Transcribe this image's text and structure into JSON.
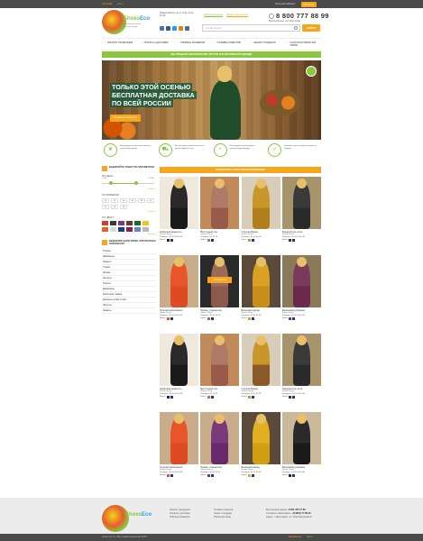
{
  "topbar": {
    "lang_ru": "Русский",
    "lang_en": "Англ.",
    "account": "Личный кабинет",
    "register": "Регистр."
  },
  "header": {
    "brand_a": "Shoes",
    "brand_b": "Eco",
    "tagline": "экологически чистая женская одежда",
    "schedule": "Режим работы: пн-пт 9-18, сб-вс 10-16",
    "callback": "Обратный звонок",
    "call_free": "Звонок бесплатный",
    "phone": "8 800 777 88 99",
    "phone_sub": "бесплатно по России"
  },
  "search": {
    "placeholder": "Что Вы ищете?",
    "button": "НАЙТИ"
  },
  "nav": {
    "items": [
      {
        "label": "КАТАЛОГ ПРОДУКЦИИ"
      },
      {
        "label": "ОПЛАТА И ДОСТАВКА"
      },
      {
        "label": "ТАБЛИЦА РАЗМЕРОВ"
      },
      {
        "label": "ОТЗЫВЫ КЛИЕНТОВ"
      },
      {
        "label": "АКЦИИ И ПОДАРКИ"
      },
      {
        "label": "КОНТАКТЫ ОБРАТНАЯ СВЯЗЬ"
      }
    ]
  },
  "banner_strip": "МЫ ПРОДАЕМ ЭКОЛОГИЧЕСКИ ЧИСТУЮ И КАЧЕСТВЕННУЮ ОДЕЖДУ",
  "hero": {
    "line1": "ТОЛЬКО ЭТОЙ ОСЕНЬЮ",
    "line2": "БЕСПЛАТНАЯ ДОСТАВКА",
    "line3": "ПО ВСЕЙ РОССИИ",
    "cta": "Перейти в каталог"
  },
  "features": [
    {
      "text": "Используем только экологически чистые материалы"
    },
    {
      "text": "Мы доставим товар бесплатно в любой город России"
    },
    {
      "text": "Мы продаем экологичную и качественную одежду"
    },
    {
      "text": "Большой опыт в сфере розничных продаж"
    }
  ],
  "filters": {
    "title": "ВЫБИРАЙТЕ ТОВАР ПО ПАРАМЕТРАМ",
    "price_label": "ПО ЦЕНЕ",
    "price_min": "1 000",
    "price_max": "15 000",
    "reset": "Сбросить",
    "size_label": "ПО РАЗМЕРАМ",
    "sizes": [
      "40",
      "42",
      "44",
      "46",
      "48",
      "50",
      "52",
      "54",
      "56"
    ],
    "color_label": "ПО ЦВЕТУ",
    "colors": [
      "#d93a2b",
      "#3b3b3b",
      "#7a3a8c",
      "#6b3a1f",
      "#1f6b2a",
      "#e8c81b",
      "#e5602a",
      "#d9d9d9",
      "#1f3a8c",
      "#8c1f4d",
      "#5a8cc6",
      "#b8b8b8"
    ],
    "cats_title": "ВЫБЕРИТЕ КАТЕГОРИЮ, КОТОРАЯ ВАС ИНТЕРЕСУЕТ",
    "categories": [
      "Платья",
      "Джемперы",
      "Жакеты",
      "Туники",
      "Штаны",
      "Жилеты",
      "Платья",
      "Джемперы",
      "Категория товара",
      "Длинное слово слово",
      "Жилеты",
      "Жакеты"
    ]
  },
  "catalog": {
    "title": "ПОСМОТРИТЕ НАШУ НОВУЮ КОЛЛЕКЦИЮ",
    "hot_label": "Посмотреть",
    "brand_label": "Фирма",
    "sizes_prefix": "Размеры:",
    "colors_prefix": "Цвета:",
    "products": [
      {
        "name": "Небесная нежность",
        "brand": "Nepal",
        "sizes": "40 42 44 46 48",
        "top": "#2a2a2a",
        "bottom": "#1a1a1a",
        "bg": "#efe8dc"
      },
      {
        "name": "Восточный сон",
        "brand": "Nepal",
        "sizes": "40 42 44",
        "top": "#b07a6a",
        "bottom": "#9a5a4a",
        "bg": "#c08a5a"
      },
      {
        "name": "Строгая Бриен",
        "brand": "Nepal",
        "sizes": "40 42 44 46",
        "top": "#c9962a",
        "bottom": "#b07e1a",
        "bg": "#d8cdb8"
      },
      {
        "name": "Разделитель ночи",
        "brand": "Nepal",
        "sizes": "40 42 44 46 48",
        "top": "#3a3a3a",
        "bottom": "#2a2a2a",
        "bg": "#a8946c"
      },
      {
        "name": "Лучший комплимент",
        "brand": "Nepal",
        "sizes": "40 42 44 46 48",
        "top": "#e8552a",
        "bottom": "#e04a22",
        "bg": "#c9ad8a"
      },
      {
        "name": "Привет, романтика",
        "brand": "Nepal",
        "sizes": "40 42 44 46",
        "top": "#9c6a5a",
        "bottom": "#8a5a4a",
        "bg": "#2a2a2a"
      },
      {
        "name": "Вечерний наряд",
        "brand": "Nepal",
        "sizes": "40 42 44 46",
        "top": "#d9a024",
        "bottom": "#c88e1a",
        "bg": "#5a4a3a"
      },
      {
        "name": "Фиалковая рубашка",
        "brand": "Nepal",
        "sizes": "40 42 44 46 48",
        "top": "#7a3a5a",
        "bottom": "#6a2a4a",
        "bg": "#8a7a5a"
      },
      {
        "name": "Небесная нежность",
        "brand": "Nepal",
        "sizes": "40 42 44 46 48",
        "top": "#2a2a2a",
        "bottom": "#1a1a1a",
        "bg": "#efe8dc"
      },
      {
        "name": "Восточный сон",
        "brand": "Nepal",
        "sizes": "40 42 44",
        "top": "#b07a6a",
        "bottom": "#9a5a4a",
        "bg": "#c08a5a"
      },
      {
        "name": "Строгая Бриен",
        "brand": "Nepal",
        "sizes": "40 42 44 46",
        "top": "#c9962a",
        "bottom": "#8a5a2a",
        "bg": "#d8cdb8"
      },
      {
        "name": "Разделитель ночи",
        "brand": "Nepal",
        "sizes": "40 42 44 46 48",
        "top": "#3a3a3a",
        "bottom": "#2a2a2a",
        "bg": "#a8946c"
      },
      {
        "name": "Лучший комплимент",
        "brand": "Nepal",
        "sizes": "40 42 44 46 48",
        "top": "#e8552a",
        "bottom": "#e04a22",
        "bg": "#c9ad8a"
      },
      {
        "name": "Привет, романтика",
        "brand": "Nepal",
        "sizes": "40 42 44 46",
        "top": "#7a3a7a",
        "bottom": "#6a2a6a",
        "bg": "#c9ad8a"
      },
      {
        "name": "Вечерний наряд",
        "brand": "Nepal",
        "sizes": "40 42 44 46",
        "top": "#e0b020",
        "bottom": "#d0a010",
        "bg": "#5a4a3a"
      },
      {
        "name": "Фиалковая рубашка",
        "brand": "Nepal",
        "sizes": "40 42 44 46 48",
        "top": "#2a2a2a",
        "bottom": "#1a1a1a",
        "bg": "#c9b89a"
      }
    ]
  },
  "footer": {
    "col1": [
      "Каталог продукции",
      "Оплата и доставка",
      "Таблица размеров"
    ],
    "col2": [
      "Отзывы клиентов",
      "Акции и подарки",
      "Обратная связь"
    ],
    "contact_phone_label": "Бесплатный звонок:",
    "contact_phone": "8 800 456 77 88",
    "contact_local_label": "Телефон в Ярославле:",
    "contact_local": "+7(4852) 77 88 99",
    "address": "Адрес: г. Ярославль, ул. Комсомольская 5",
    "copyright": "shoes-eco.ru | Все права защищены 2015",
    "dev_a": "Разработка",
    "dev_b": "сайта"
  }
}
